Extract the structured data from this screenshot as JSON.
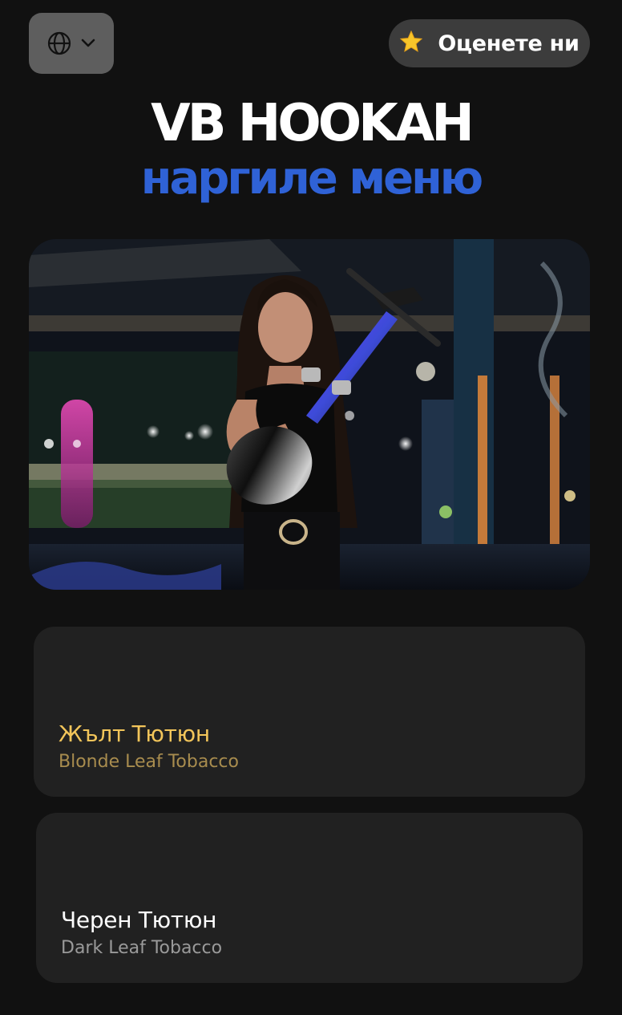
{
  "header": {
    "language_icon": "globe-icon",
    "language_dropdown_icon": "chevron-down-icon",
    "rate_icon": "star-icon",
    "rate_label": "Оценете ни"
  },
  "brand": {
    "title": "VB HOOKAH",
    "subtitle": "наргиле меню"
  },
  "colors": {
    "background": "#111111",
    "subtitle_blue": "#2f62d6",
    "card_background": "#212121",
    "blonde_accent": "#f2c55a",
    "blonde_sub": "#a88c4e"
  },
  "categories": [
    {
      "title": "Жълт Тютюн",
      "subtitle": "Blonde Leaf Tobacco"
    },
    {
      "title": "Черен Тютюн",
      "subtitle": "Dark Leaf Tobacco"
    }
  ]
}
